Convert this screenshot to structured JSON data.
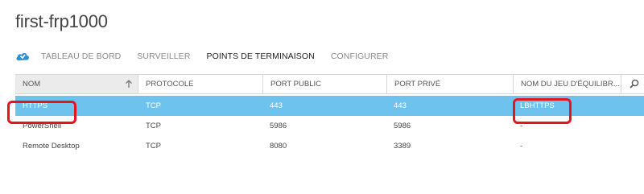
{
  "page": {
    "title": "first-frp1000"
  },
  "nav": {
    "icon": "cloud-service-icon",
    "items": [
      {
        "label": "TABLEAU DE BORD",
        "active": false
      },
      {
        "label": "SURVEILLER",
        "active": false
      },
      {
        "label": "POINTS DE TERMINAISON",
        "active": true
      },
      {
        "label": "CONFIGURER",
        "active": false
      }
    ]
  },
  "table": {
    "columns": [
      "NOM",
      "PROTOCOLE",
      "PORT PUBLIC",
      "PORT PRIVÉ",
      "NOM DU JEU D'ÉQUILIBR..."
    ],
    "sort_icon": "sort-up-arrow-icon",
    "search_icon": "search-icon",
    "rows": [
      {
        "name": "HTTPS",
        "protocol": "TCP",
        "public_port": "443",
        "private_port": "443",
        "lb_set": "LBHTTPS",
        "selected": true
      },
      {
        "name": "PowerShell",
        "protocol": "TCP",
        "public_port": "5986",
        "private_port": "5986",
        "lb_set": "-",
        "selected": false
      },
      {
        "name": "Remote Desktop",
        "protocol": "TCP",
        "public_port": "8080",
        "private_port": "3389",
        "lb_set": "-",
        "selected": false
      }
    ]
  },
  "colors": {
    "selected_row": "#6dc3ee",
    "highlight_outline": "#e8141b",
    "nav_icon": "#2f8fd6"
  }
}
